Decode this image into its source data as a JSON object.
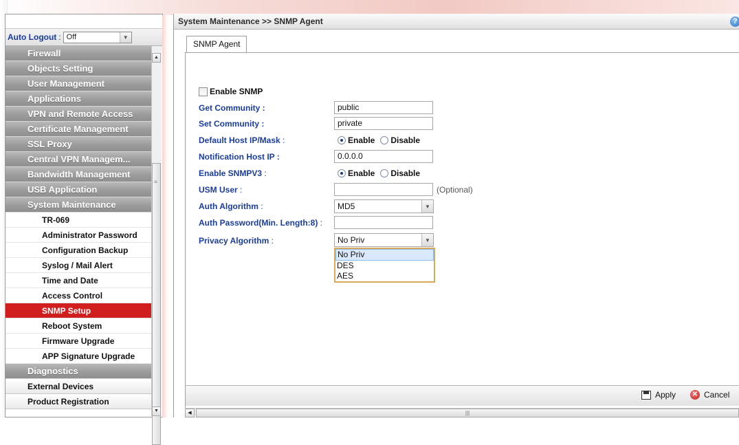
{
  "sidebar": {
    "auto_logout_label": "Auto Logout",
    "auto_logout_value": "Off",
    "menu": [
      {
        "label": "Firewall",
        "type": "main"
      },
      {
        "label": "Objects Setting",
        "type": "main"
      },
      {
        "label": "User Management",
        "type": "main"
      },
      {
        "label": "Applications",
        "type": "main"
      },
      {
        "label": "VPN and Remote Access",
        "type": "main"
      },
      {
        "label": "Certificate Management",
        "type": "main"
      },
      {
        "label": "SSL Proxy",
        "type": "main"
      },
      {
        "label": "Central VPN Managem...",
        "type": "main"
      },
      {
        "label": "Bandwidth Management",
        "type": "main"
      },
      {
        "label": "USB Application",
        "type": "main"
      },
      {
        "label": "System Maintenance",
        "type": "main"
      },
      {
        "label": "TR-069",
        "type": "sub"
      },
      {
        "label": "Administrator Password",
        "type": "sub"
      },
      {
        "label": "Configuration Backup",
        "type": "sub"
      },
      {
        "label": "Syslog / Mail Alert",
        "type": "sub"
      },
      {
        "label": "Time and Date",
        "type": "sub"
      },
      {
        "label": "Access Control",
        "type": "sub"
      },
      {
        "label": "SNMP Setup",
        "type": "sub",
        "active": true
      },
      {
        "label": "Reboot System",
        "type": "sub"
      },
      {
        "label": "Firmware Upgrade",
        "type": "sub"
      },
      {
        "label": "APP Signature Upgrade",
        "type": "sub"
      },
      {
        "label": "Diagnostics",
        "type": "main"
      },
      {
        "label": "External Devices",
        "type": "plain"
      },
      {
        "label": "Product Registration",
        "type": "plain"
      }
    ]
  },
  "header": {
    "breadcrumb": "System Maintenance >> SNMP Agent",
    "help_icon": "?"
  },
  "tabs": [
    {
      "label": "SNMP Agent"
    }
  ],
  "form": {
    "enable_snmp_label": "Enable SNMP",
    "enable_snmp_checked": false,
    "get_community_label": "Get Community :",
    "get_community_value": "public",
    "set_community_label": "Set Community :",
    "set_community_value": "private",
    "default_host_label": "Default Host IP/Mask",
    "default_host_colon": ":",
    "notification_host_label": "Notification Host IP :",
    "notification_host_value": "0.0.0.0",
    "enable_snmpv3_label": "Enable SNMPV3",
    "enable_snmpv3_colon": ":",
    "enable_label": "Enable",
    "disable_label": "Disable",
    "usm_user_label": "USM User",
    "usm_user_colon": ":",
    "usm_user_value": "",
    "optional_text": "(Optional)",
    "auth_algorithm_label": "Auth Algorithm",
    "auth_algorithm_colon": ":",
    "auth_algorithm_value": "MD5",
    "auth_password_label": "Auth Password(Min. Length:8)",
    "auth_password_colon": ":",
    "auth_password_value": "",
    "privacy_algorithm_label": "Privacy Algorithm",
    "privacy_algorithm_colon": ":",
    "privacy_algorithm_value": "No Priv",
    "privacy_options": [
      "No Priv",
      "DES",
      "AES"
    ]
  },
  "footer": {
    "apply_label": "Apply",
    "cancel_label": "Cancel"
  },
  "colors": {
    "menu_grey": "#9c9c9c",
    "active_red": "#d11f1f",
    "label_blue": "#1a3c9c",
    "dropdown_border": "#d9a95b"
  }
}
